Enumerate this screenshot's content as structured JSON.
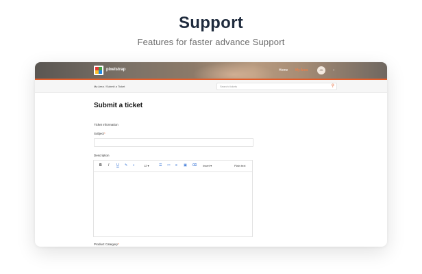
{
  "hero": {
    "title": "Support",
    "subtitle": "Features for faster advance Support"
  },
  "app": {
    "brand": "pixelstrap",
    "nav": {
      "home": "Home",
      "my_area": "My Area"
    },
    "avatar_initials": "JD",
    "accent_color": "#e35d2a",
    "breadcrumb": "My Area  /  Submit a Ticket",
    "search": {
      "placeholder": "Search tickets",
      "icon": "search-icon"
    }
  },
  "form": {
    "title": "Submit a ticket",
    "section": "Ticket Information",
    "subject_label": "Subject",
    "subject_required": "*",
    "subject_value": "",
    "description_label": "Description",
    "toolbar": {
      "bold": "B",
      "italic": "I",
      "underline": "U",
      "font_size": "12 ▾",
      "insert": "Insert ▾",
      "plain_text": "Plain text"
    },
    "category_label": "Product Category",
    "category_required": "*"
  }
}
